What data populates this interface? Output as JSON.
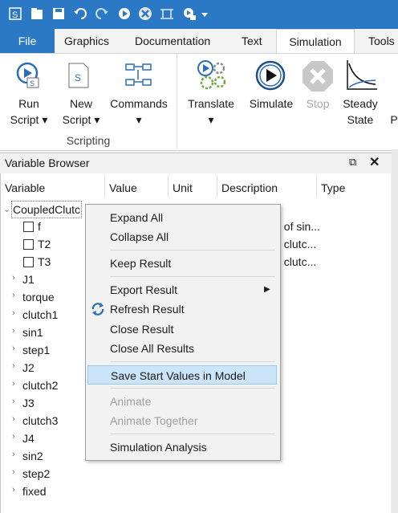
{
  "quick_access": {
    "icons": [
      "app-icon",
      "open-icon",
      "save-icon",
      "undo-icon",
      "redo-icon",
      "simulate-icon",
      "stop-icon",
      "scale-icon",
      "script-icon",
      "dropdown-icon"
    ]
  },
  "ribbon_tabs": [
    "File",
    "Graphics",
    "Documentation",
    "Text",
    "Simulation",
    "Tools"
  ],
  "ribbon": {
    "run_script": [
      "Run",
      "Script"
    ],
    "new_script": [
      "New",
      "Script"
    ],
    "commands": "Commands",
    "scripting_group": "Scripting",
    "translate": "Translate",
    "simulate": "Simulate",
    "stop": "Stop",
    "steady_state": [
      "Steady",
      "State"
    ],
    "partial": "P"
  },
  "variable_browser": {
    "title": "Variable Browser",
    "columns": [
      "Variable",
      "Value",
      "Unit",
      "Description",
      "Type"
    ],
    "root": "CoupledClutc",
    "params": [
      "f",
      "T2",
      "T3"
    ],
    "desc_fragments": [
      "f of sin...",
      "t clutc...",
      "t clutc..."
    ],
    "children": [
      "J1",
      "torque",
      "clutch1",
      "sin1",
      "step1",
      "J2",
      "clutch2",
      "J3",
      "clutch3",
      "J4",
      "sin2",
      "step2",
      "fixed"
    ]
  },
  "context_menu": {
    "expand_all": "Expand All",
    "collapse_all": "Collapse All",
    "keep_result": "Keep Result",
    "export_result": "Export Result",
    "refresh_result": "Refresh Result",
    "close_result": "Close Result",
    "close_all_results": "Close All Results",
    "save_start_values": "Save Start Values in Model",
    "animate": "Animate",
    "animate_together": "Animate Together",
    "simulation_analysis": "Simulation Analysis"
  }
}
